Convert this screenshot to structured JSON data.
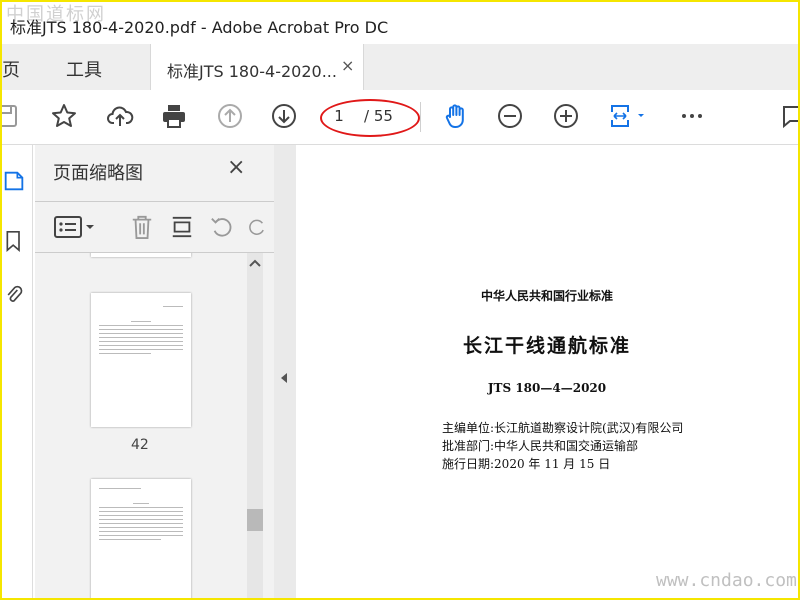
{
  "watermark_top": "中国道标网",
  "watermark_bottom": "www.cndao.com",
  "window": {
    "title": "标准JTS 180-4-2020.pdf - Adobe Acrobat Pro DC"
  },
  "tabs": {
    "home": "主页",
    "tools": "工具",
    "document": "标准JTS 180-4-2020...",
    "close_symbol": "×"
  },
  "toolbar": {
    "page_current": "1",
    "page_total": "/ 55",
    "icons": [
      "save-icon",
      "star-icon",
      "cloud-upload-icon",
      "print-icon",
      "page-up-icon",
      "page-down-icon",
      "hand-icon",
      "zoom-out-icon",
      "zoom-in-icon",
      "fit-page-icon",
      "more-icon"
    ]
  },
  "panel": {
    "title": "页面缩略图",
    "close_symbol": "×",
    "thumbnails": [
      {
        "page_number": "42"
      }
    ]
  },
  "document": {
    "header": "中华人民共和国行业标准",
    "title": "长江干线通航标准",
    "code": "JTS 180—4—2020",
    "editor": "主编单位:长江航道勘察设计院(武汉)有限公司",
    "approver": "批准部门:中华人民共和国交通运输部",
    "effective": "施行日期:2020 年 11 月 15 日"
  },
  "colors": {
    "accent": "#1473e6",
    "annotation": "#e01818",
    "border": "#f5e600"
  }
}
